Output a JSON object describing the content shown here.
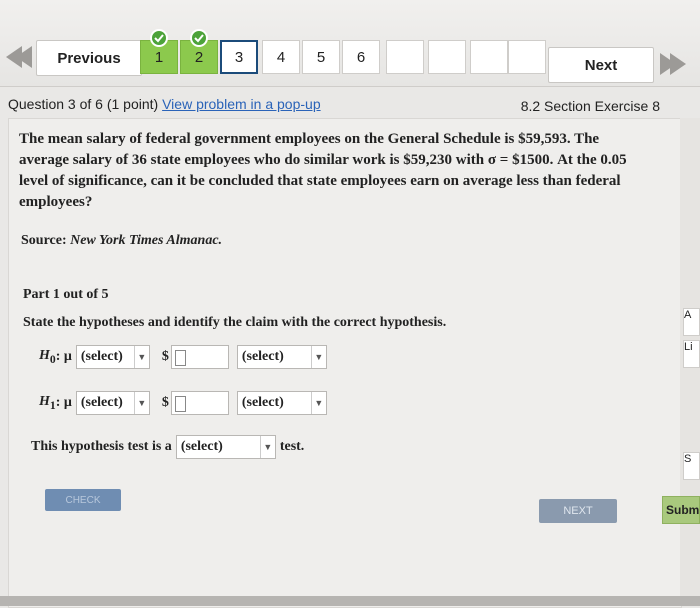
{
  "nav": {
    "previous_label": "Previous",
    "next_label": "Next",
    "questions": [
      {
        "label": "1",
        "status": "done"
      },
      {
        "label": "2",
        "status": "done"
      },
      {
        "label": "3",
        "status": "current"
      },
      {
        "label": "4",
        "status": "open"
      },
      {
        "label": "5",
        "status": "open"
      },
      {
        "label": "6",
        "status": "open"
      }
    ]
  },
  "question": {
    "number_text": "Question 3 of 6 (1 point)",
    "popup_link": "View problem in a pop-up",
    "section": "8.2 Section Exercise 8"
  },
  "problem": {
    "line1": "The mean salary of federal government employees on the General Schedule is $59,593. The",
    "line2a": "average salary of 36 state employees who do similar work is $59,230 with",
    "line2b": "σ = $1500. At the 0.05",
    "line3": "level of significance, can it be concluded that state employees earn on average less than federal",
    "line4": "employees?",
    "source_label": "Source:",
    "source_title": "New York Times Almanac."
  },
  "part": {
    "title": "Part 1 out of 5",
    "instruction": "State the hypotheses and identify the claim with the correct hypothesis.",
    "h0_label": "H",
    "h0_sub": "0",
    "h1_label": "H",
    "h1_sub": "1",
    "mu": ": μ",
    "select_placeholder": "(select)",
    "dollar": "$",
    "test_prefix": "This hypothesis test is a",
    "test_suffix": "test."
  },
  "buttons": {
    "check": "CHECK",
    "next": "NEXT"
  },
  "right_tabs": [
    "A",
    "Li",
    "S",
    "Subm"
  ],
  "colors": {
    "done_green": "#8cc94d",
    "link_blue": "#2a63b8",
    "current_border": "#1b4b7a",
    "check_button": "#6f8db2"
  }
}
